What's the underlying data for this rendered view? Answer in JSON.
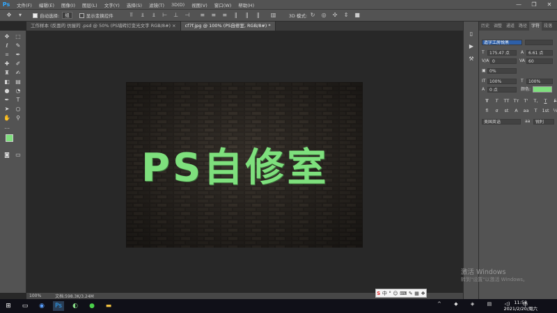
{
  "app": {
    "logo": "Ps"
  },
  "menu": [
    "文件(F)",
    "编辑(E)",
    "图像(I)",
    "图层(L)",
    "文字(Y)",
    "选择(S)",
    "滤镜(T)",
    "3D(D)",
    "视图(V)",
    "窗口(W)",
    "帮助(H)"
  ],
  "window_controls": {
    "minimize": "—",
    "restore": "❐",
    "close": "✕"
  },
  "options_bar": {
    "auto_select_label": "自动选择:",
    "auto_select_value": "组",
    "show_transform_label": "显示变换控件"
  },
  "tabs": [
    {
      "label": "工作样本 (反面的 仿屋的 .psd @ 50% (PS墙砖灯变光文字 RGB/8#) ×",
      "active": false
    },
    {
      "label": "cf7f.jpg @ 100% (PS自修室, RGB/8#) *",
      "active": true
    }
  ],
  "canvas": {
    "text": "PS自修室",
    "text_color": "#7ee07d",
    "bg_color": "#2a2622"
  },
  "status_bar": {
    "zoom": "100%",
    "doc_info": "文档:598.3K/3.24M"
  },
  "panel": {
    "tabs": [
      "历史",
      "调整",
      "通道",
      "路径",
      "字符",
      "段落"
    ],
    "active_tab": "字符",
    "font_family": "造字工房悦黑",
    "font_size": "175.47 点",
    "leading": "6.61 点",
    "kerning": "0",
    "tracking": "60",
    "baseline_pct": "0%",
    "vscale": "100%",
    "hscale": "100%",
    "baseline_shift": "0 点",
    "color_label": "颜色:",
    "color_value": "#7ee07d",
    "format_buttons": [
      "T",
      "T",
      "TT",
      "Tт",
      "T'",
      "T,",
      "T",
      "F"
    ],
    "format_buttons2": [
      "fi",
      "σ",
      "st",
      "A",
      "aa",
      "T",
      "1st",
      "½"
    ],
    "language": "美国英语",
    "aa_label": "aa",
    "aa_value": "锐利"
  },
  "watermark": {
    "line1": "激活 Windows",
    "line2": "转到\"设置\"以激活 Windows。"
  },
  "ime": [
    "S",
    "中",
    "°",
    "☺",
    "⌨",
    "✎",
    "▦",
    "❖"
  ],
  "clock": {
    "time": "11:58",
    "date": "2021/2/20/周六"
  }
}
